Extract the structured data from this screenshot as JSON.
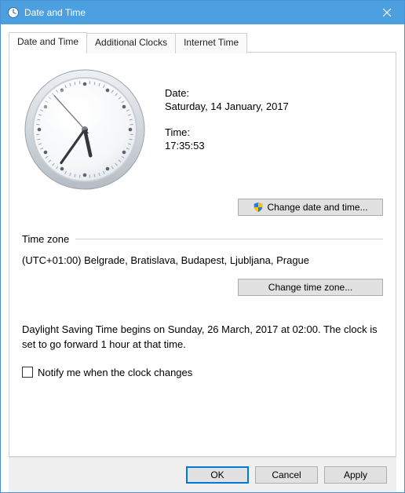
{
  "window": {
    "title": "Date and Time"
  },
  "tabs": [
    {
      "label": "Date and Time",
      "active": true
    },
    {
      "label": "Additional Clocks",
      "active": false
    },
    {
      "label": "Internet Time",
      "active": false
    }
  ],
  "datetime": {
    "date_label": "Date:",
    "date_value": "Saturday, 14 January, 2017",
    "time_label": "Time:",
    "time_value": "17:35:53",
    "change_datetime_label": "Change date and time..."
  },
  "timezone": {
    "section_label": "Time zone",
    "value": "(UTC+01:00) Belgrade, Bratislava, Budapest, Ljubljana, Prague",
    "change_timezone_label": "Change time zone..."
  },
  "dst": {
    "text": "Daylight Saving Time begins on Sunday, 26 March, 2017 at 02:00. The clock is set to go forward 1 hour at that time.",
    "notify_label": "Notify me when the clock changes",
    "notify_checked": false
  },
  "footer": {
    "ok": "OK",
    "cancel": "Cancel",
    "apply": "Apply"
  },
  "clock": {
    "hour": 17,
    "minute": 35,
    "second": 53
  }
}
